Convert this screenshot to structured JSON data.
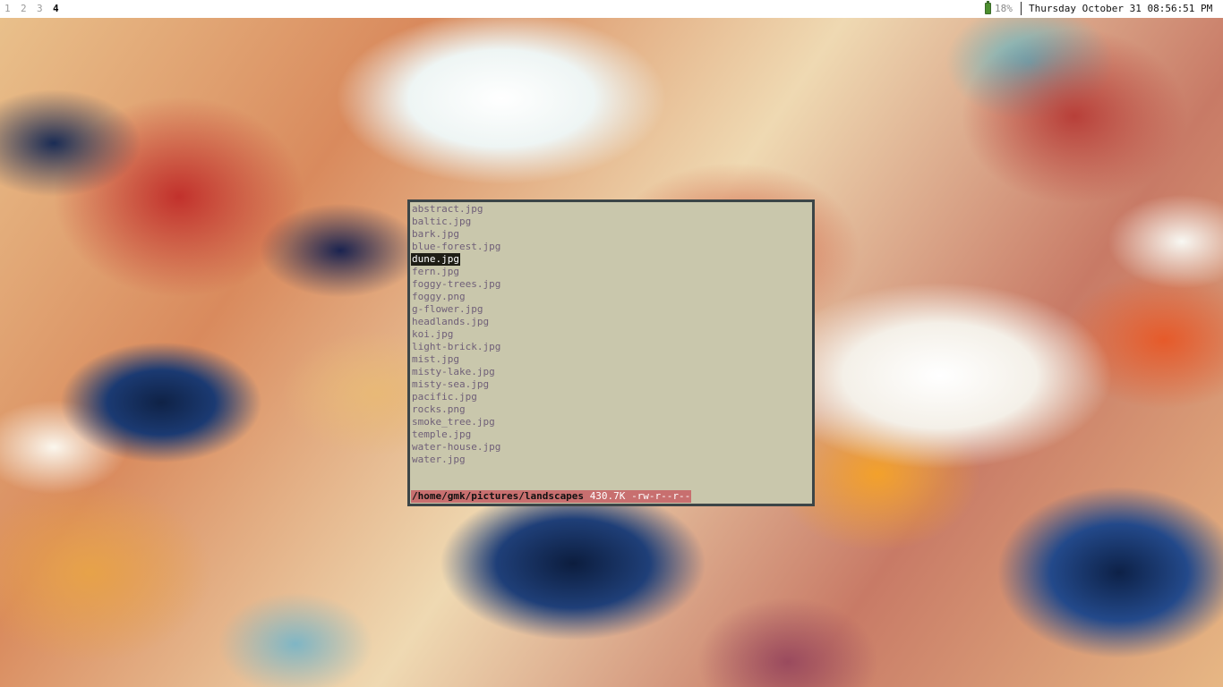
{
  "topbar": {
    "workspaces": [
      "1",
      "2",
      "3",
      "4"
    ],
    "active_workspace": "4",
    "battery": {
      "icon": "battery-icon",
      "percent": "18%",
      "level": 0.18,
      "color": "#4c8f2f"
    },
    "separator": "|",
    "clock": "Thursday October 31 08:56:51 PM"
  },
  "ranger": {
    "files": [
      "abstract.jpg",
      "baltic.jpg",
      "bark.jpg",
      "blue-forest.jpg",
      "dune.jpg",
      "fern.jpg",
      "foggy-trees.jpg",
      "foggy.png",
      "g-flower.jpg",
      "headlands.jpg",
      "koi.jpg",
      "light-brick.jpg",
      "mist.jpg",
      "misty-lake.jpg",
      "misty-sea.jpg",
      "pacific.jpg",
      "rocks.png",
      "smoke_tree.jpg",
      "temple.jpg",
      "water-house.jpg",
      "water.jpg"
    ],
    "selected": "dune.jpg",
    "status": {
      "path": "/home/gmk/pictures/landscapes",
      "size": "430.7K",
      "permissions": "-rw-r--r--"
    },
    "colors": {
      "background": "#c9c7ac",
      "text": "#6f5f78",
      "selection": "#1e1d15",
      "status_bar": "#c86f6f",
      "border": "#3c4547"
    }
  }
}
